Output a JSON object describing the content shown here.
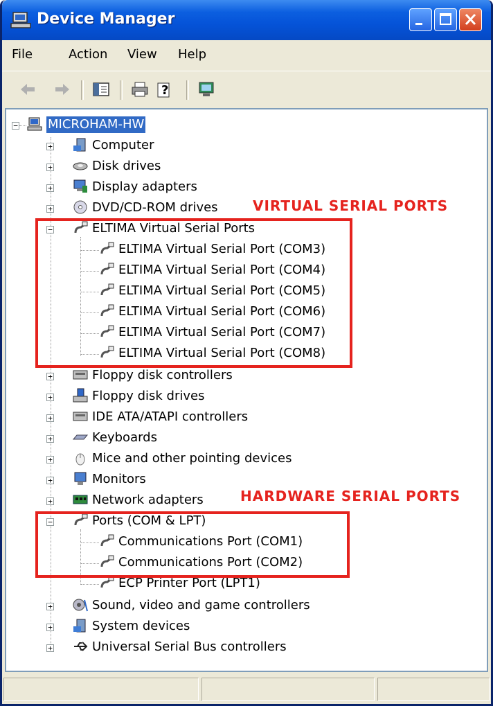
{
  "window": {
    "title": "Device Manager",
    "controls": [
      "minimize",
      "maximize",
      "close"
    ]
  },
  "menu": {
    "file": "File",
    "action": "Action",
    "view": "View",
    "help": "Help"
  },
  "toolbar": {
    "icons": [
      "back-icon",
      "forward-icon",
      "show-hide-console-tree-icon",
      "print-icon",
      "properties-help-icon",
      "scan-hardware-icon"
    ]
  },
  "tree": {
    "root": "MICROHAM-HW",
    "categories": [
      {
        "label": "Computer"
      },
      {
        "label": "Disk drives"
      },
      {
        "label": "Display adapters"
      },
      {
        "label": "DVD/CD-ROM drives"
      },
      {
        "label": "ELTIMA Virtual Serial Ports",
        "children": [
          "ELTIMA Virtual Serial Port (COM3)",
          "ELTIMA Virtual Serial Port (COM4)",
          "ELTIMA Virtual Serial Port (COM5)",
          "ELTIMA Virtual Serial Port (COM6)",
          "ELTIMA Virtual Serial Port (COM7)",
          "ELTIMA Virtual Serial Port (COM8)"
        ]
      },
      {
        "label": "Floppy disk controllers"
      },
      {
        "label": "Floppy disk drives"
      },
      {
        "label": "IDE ATA/ATAPI controllers"
      },
      {
        "label": "Keyboards"
      },
      {
        "label": "Mice and other pointing devices"
      },
      {
        "label": "Monitors"
      },
      {
        "label": "Network adapters"
      },
      {
        "label": "Ports (COM & LPT)",
        "children": [
          "Communications Port (COM1)",
          "Communications Port (COM2)",
          "ECP Printer Port (LPT1)"
        ]
      },
      {
        "label": "Sound, video and game controllers"
      },
      {
        "label": "System devices"
      },
      {
        "label": "Universal Serial Bus controllers"
      }
    ]
  },
  "annotations": {
    "virtual": "VIRTUAL SERIAL PORTS",
    "hardware": "HARDWARE SERIAL PORTS",
    "color": "#E5231E"
  },
  "colors": {
    "titlebar": "#0553D8",
    "selection": "#316AC5",
    "chrome": "#ECE9D8"
  }
}
